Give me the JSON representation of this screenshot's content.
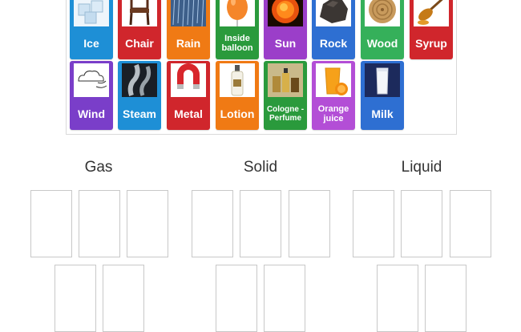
{
  "tiles": [
    {
      "label": "Ice",
      "color": "#1e8fd6",
      "icon": "ice-cubes-icon"
    },
    {
      "label": "Chair",
      "color": "#d0262c",
      "icon": "chair-icon"
    },
    {
      "label": "Rain",
      "color": "#f07a14",
      "icon": "rain-icon"
    },
    {
      "label": "Inside balloon",
      "color": "#2a9a3c",
      "icon": "balloon-icon"
    },
    {
      "label": "Sun",
      "color": "#9b3ec9",
      "icon": "sun-icon"
    },
    {
      "label": "Rock",
      "color": "#2e6fd2",
      "icon": "rock-icon"
    },
    {
      "label": "Wood",
      "color": "#35b05a",
      "icon": "wood-log-icon"
    },
    {
      "label": "Syrup",
      "color": "#d0262c",
      "icon": "syrup-spoon-icon"
    },
    {
      "label": "Wind",
      "color": "#7a3ec9",
      "icon": "wind-cloud-icon"
    },
    {
      "label": "Steam",
      "color": "#1e8fd6",
      "icon": "steam-icon"
    },
    {
      "label": "Metal",
      "color": "#d0262c",
      "icon": "magnet-icon"
    },
    {
      "label": "Lotion",
      "color": "#f07a14",
      "icon": "lotion-bottle-icon"
    },
    {
      "label": "Cologne - Perfume",
      "color": "#2a9a3c",
      "icon": "perfume-icon"
    },
    {
      "label": "Orange juice",
      "color": "#b34ed6",
      "icon": "orange-juice-icon"
    },
    {
      "label": "Milk",
      "color": "#2e6fd2",
      "icon": "milk-glass-icon"
    }
  ],
  "groups": [
    {
      "title": "Gas"
    },
    {
      "title": "Solid"
    },
    {
      "title": "Liquid"
    }
  ]
}
